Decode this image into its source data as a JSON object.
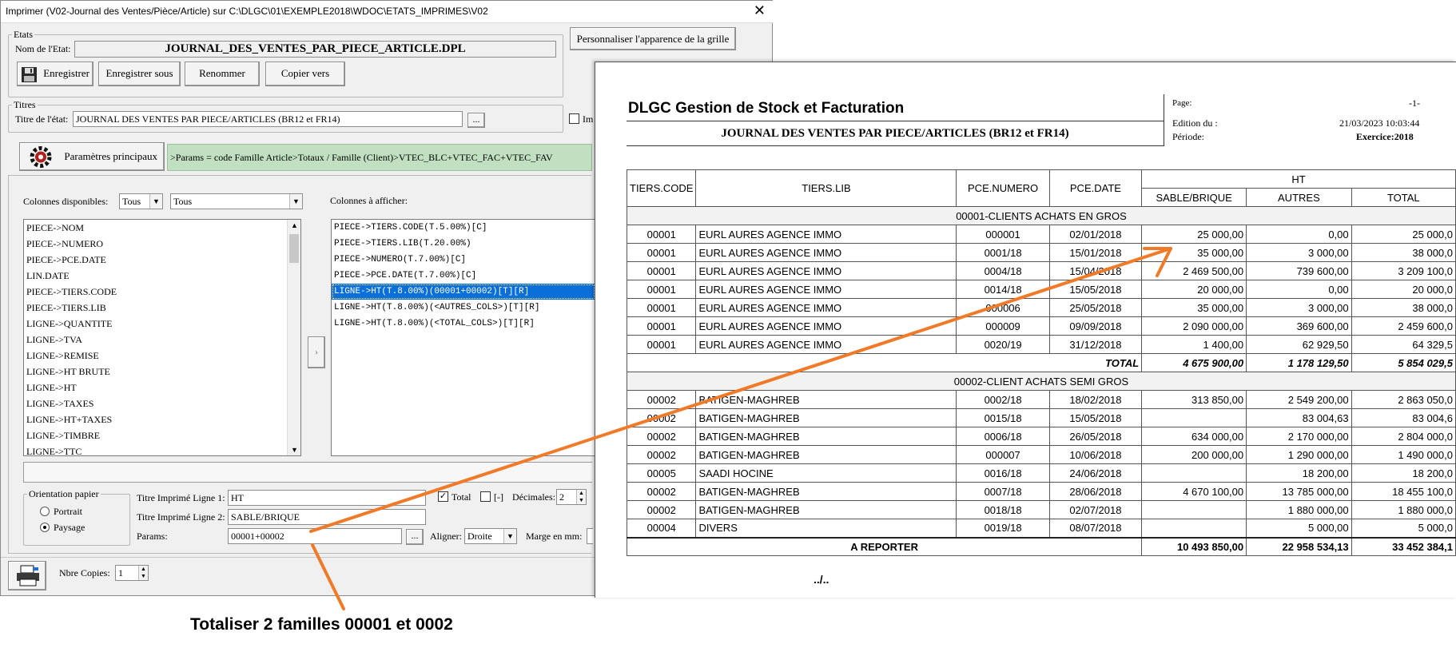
{
  "dialog": {
    "title": "Imprimer (V02-Journal des Ventes/Pièce/Article)  sur C:\\DLGC\\01\\EXEMPLE2018\\WDOC\\ETATS_IMPRIMES\\V02",
    "close_glyph": "✕",
    "customize_button": "Personnaliser l'apparence de la grille",
    "etats": {
      "legend": "Etats",
      "name_label": "Nom de l'Etat:",
      "name_value": "JOURNAL_DES_VENTES_PAR_PIECE_ARTICLE.DPL",
      "buttons": {
        "save": "Enregistrer",
        "save_as": "Enregistrer sous",
        "rename": "Renommer",
        "copy_to": "Copier vers"
      }
    },
    "titres": {
      "legend": "Titres",
      "title_label": "Titre de l'état:",
      "title_value": "JOURNAL DES VENTES  PAR PIECE/ARTICLES (BR12 et FR14)",
      "browse": "...",
      "right_check_label": "Im"
    },
    "params": {
      "button": "Paramètres principaux",
      "summary": ">Params = code Famille Article>Totaux / Famille (Client)>VTEC_BLC+VTEC_FAC+VTEC_FAV"
    },
    "columns": {
      "available_label": "Colonnes disponibles:",
      "filter1": "Tous",
      "filter2": "Tous",
      "display_label": "Colonnes à afficher:",
      "available": [
        "PIECE->NOM",
        "PIECE->NUMERO",
        "PIECE->PCE.DATE",
        "LIN.DATE",
        "PIECE->TIERS.CODE",
        "PIECE->TIERS.LIB",
        "LIGNE->QUANTITE",
        "LIGNE->TVA",
        "LIGNE->REMISE",
        "LIGNE->HT BRUTE",
        "LIGNE->HT",
        "LIGNE->TAXES",
        "LIGNE->HT+TAXES",
        "LIGNE->TIMBRE",
        "LIGNE->TTC"
      ],
      "displayed": [
        "PIECE->TIERS.CODE(T.5.00%)[C]",
        "PIECE->TIERS.LIB(T.20.00%)",
        "PIECE->NUMERO(T.7.00%)[C]",
        "PIECE->PCE.DATE(T.7.00%)[C]",
        "LIGNE->HT(T.8.00%)(00001+00002)[T][R]",
        "LIGNE->HT(T.8.00%)(<AUTRES_COLS>)[T][R]",
        "LIGNE->HT(T.8.00%)(<TOTAL_COLS>)[T][R]"
      ],
      "selected_index": 4
    },
    "orientation": {
      "legend": "Orientation papier",
      "portrait": "Portrait",
      "landscape": "Paysage",
      "selected": "Paysage"
    },
    "print": {
      "line1_label": "Titre Imprimé Ligne 1:",
      "line1_value": "HT",
      "line2_label": "Titre Imprimé Ligne 2:",
      "line2_value": "SABLE/BRIQUE",
      "params_label": "Params:",
      "params_value": "00001+00002",
      "total_label": "Total",
      "total_checked": true,
      "minus_label": "[-]",
      "minus_checked": false,
      "decimals_label": "Décimales:",
      "decimals_value": "2",
      "align_label": "Aligner:",
      "align_value": "Droite",
      "margin_label": "Marge en mm:"
    },
    "copies": {
      "label": "Nbre Copies:",
      "value": "1"
    }
  },
  "report": {
    "company": "DLGC Gestion de Stock et Facturation",
    "title": "JOURNAL DES VENTES  PAR PIECE/ARTICLES (BR12 et FR14)",
    "page_label": "Page:",
    "page_value": "-1-",
    "edition_label": "Edition du :",
    "edition_value": "21/03/2023 10:03:44",
    "period_label": "Période:",
    "period_value": "Exercice:2018",
    "headers": {
      "code": "TIERS.CODE",
      "lib": "TIERS.LIB",
      "numero": "PCE.NUMERO",
      "date": "PCE.DATE",
      "ht": "HT",
      "sable": "SABLE/BRIQUE",
      "autres": "AUTRES",
      "total": "TOTAL"
    },
    "groups": [
      {
        "label": "00001-CLIENTS ACHATS EN GROS",
        "rows": [
          [
            "00001",
            "EURL AURES AGENCE IMMO",
            "000001",
            "02/01/2018",
            "25 000,00",
            "0,00",
            "25 000,0"
          ],
          [
            "00001",
            "EURL AURES AGENCE IMMO",
            "0001/18",
            "15/01/2018",
            "35 000,00",
            "3 000,00",
            "38 000,0"
          ],
          [
            "00001",
            "EURL AURES AGENCE IMMO",
            "0004/18",
            "15/04/2018",
            "2 469 500,00",
            "739 600,00",
            "3 209 100,0"
          ],
          [
            "00001",
            "EURL AURES AGENCE IMMO",
            "0014/18",
            "15/05/2018",
            "20 000,00",
            "0,00",
            "20 000,0"
          ],
          [
            "00001",
            "EURL AURES AGENCE IMMO",
            "000006",
            "25/05/2018",
            "35 000,00",
            "3 000,00",
            "38 000,0"
          ],
          [
            "00001",
            "EURL AURES AGENCE IMMO",
            "000009",
            "09/09/2018",
            "2 090 000,00",
            "369 600,00",
            "2 459 600,0"
          ],
          [
            "00001",
            "EURL AURES AGENCE IMMO",
            "0020/19",
            "31/12/2018",
            "1 400,00",
            "62 929,50",
            "64 329,5"
          ]
        ],
        "total": {
          "label": "TOTAL",
          "sable": "4 675 900,00",
          "autres": "1 178 129,50",
          "total": "5 854 029,5"
        }
      },
      {
        "label": "00002-CLIENT ACHATS SEMI GROS",
        "rows": [
          [
            "00002",
            "BATIGEN-MAGHREB",
            "0002/18",
            "18/02/2018",
            "313 850,00",
            "2 549 200,00",
            "2 863 050,0"
          ],
          [
            "00002",
            "BATIGEN-MAGHREB",
            "0015/18",
            "15/05/2018",
            "",
            "83 004,63",
            "83 004,6"
          ],
          [
            "00002",
            "BATIGEN-MAGHREB",
            "0006/18",
            "26/05/2018",
            "634 000,00",
            "2 170 000,00",
            "2 804 000,0"
          ],
          [
            "00002",
            "BATIGEN-MAGHREB",
            "000007",
            "10/06/2018",
            "200 000,00",
            "1 290 000,00",
            "1 490 000,0"
          ],
          [
            "00005",
            "SAADI HOCINE",
            "0016/18",
            "24/06/2018",
            "",
            "18 200,00",
            "18 200,0"
          ],
          [
            "00002",
            "BATIGEN-MAGHREB",
            "0007/18",
            "28/06/2018",
            "4 670 100,00",
            "13 785 000,00",
            "18 455 100,0"
          ],
          [
            "00002",
            "BATIGEN-MAGHREB",
            "0018/18",
            "02/07/2018",
            "",
            "1 880 000,00",
            "1 880 000,0"
          ],
          [
            "00004",
            "DIVERS",
            "0019/18",
            "08/07/2018",
            "",
            "5 000,00",
            "5 000,0"
          ]
        ]
      }
    ],
    "carry": {
      "label": "A REPORTER",
      "sable": "10 493 850,00",
      "autres": "22 958 534,13",
      "total": "33 452 384,1"
    },
    "continued": "../.."
  },
  "annotation": {
    "caption": "Totaliser 2 familles 00001 et 0002",
    "arrow_color": "#f07a28"
  }
}
